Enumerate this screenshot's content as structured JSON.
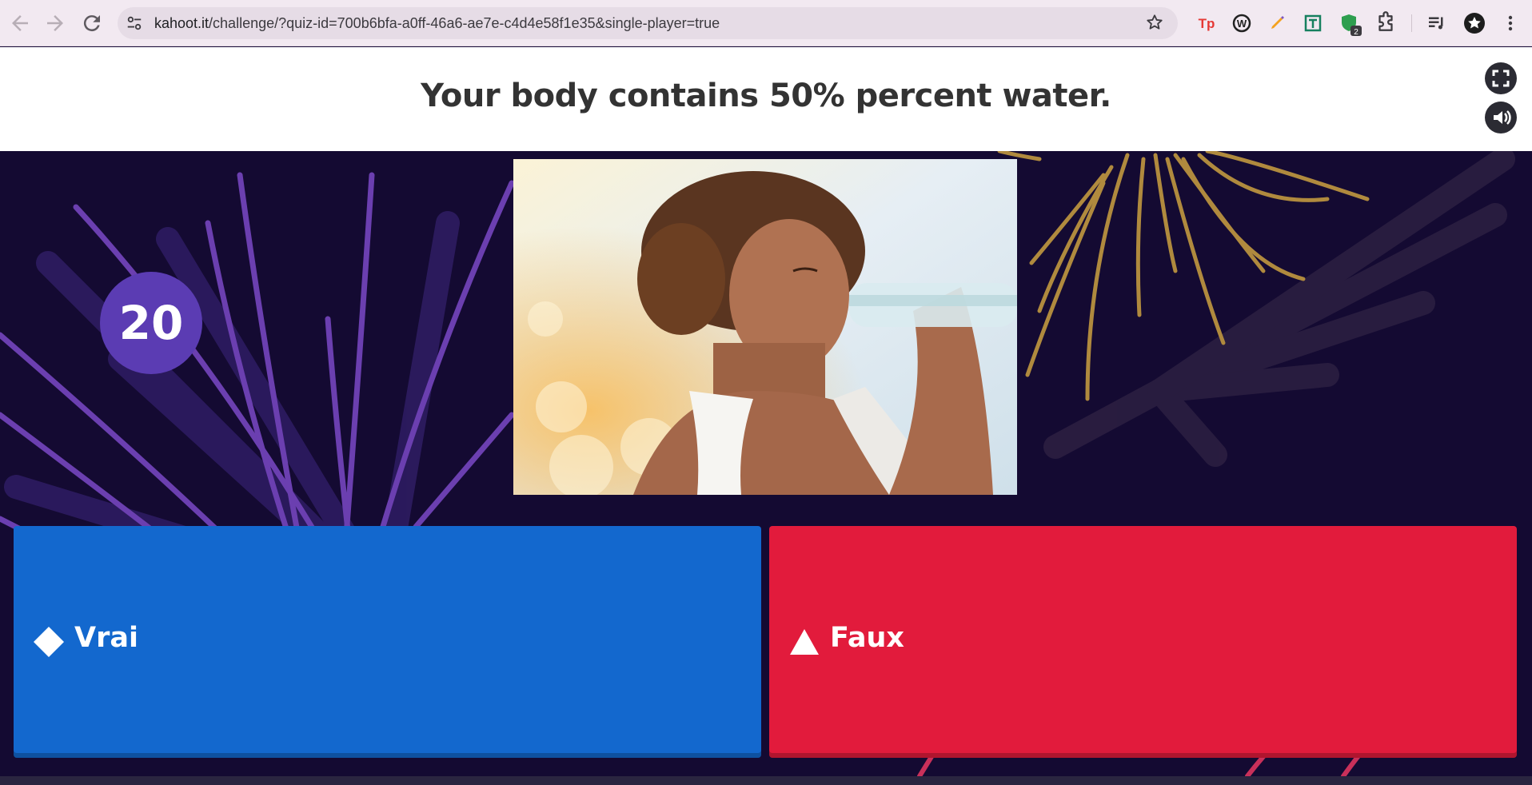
{
  "browser": {
    "url_host": "kahoot.it",
    "url_path": "/challenge/?quiz-id=700b6bfa-a0ff-46a6-ae7e-c4d4e58f1e35&single-player=true",
    "extension_badge": "2",
    "icons": [
      "back-icon",
      "forward-icon",
      "reload-icon",
      "site-info-icon",
      "bookmark-star-icon",
      "extension-tp-icon",
      "extension-w-icon",
      "extension-pen-icon",
      "extension-text-icon",
      "extension-shield-icon",
      "extensions-puzzle-icon",
      "media-queue-icon",
      "profile-avatar-icon",
      "more-menu-icon"
    ]
  },
  "question": {
    "title": "Your body contains 50% percent water."
  },
  "side_controls": {
    "icons": [
      "fullscreen-icon",
      "sound-icon"
    ]
  },
  "timer": {
    "value": "20"
  },
  "image": {
    "icon": "question-image"
  },
  "answers": [
    {
      "label": "Vrai",
      "color": "#1368ce",
      "shape": "diamond"
    },
    {
      "label": "Faux",
      "color": "#e21b3c",
      "shape": "triangle"
    }
  ],
  "colors": {
    "stage": "#140a32",
    "timer": "#5b3cb3",
    "blue": "#1368ce",
    "red": "#e21b3c"
  }
}
